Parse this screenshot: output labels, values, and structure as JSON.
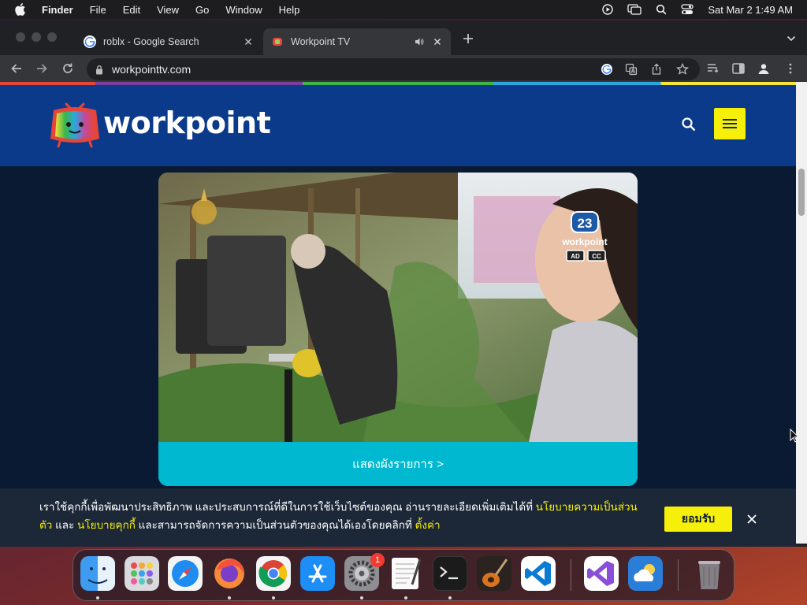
{
  "menubar": {
    "app_name": "Finder",
    "items": [
      "File",
      "Edit",
      "View",
      "Go",
      "Window",
      "Help"
    ],
    "clock": "Sat Mar 2  1:49 AM"
  },
  "tabs": [
    {
      "title": "roblx - Google Search",
      "favicon": "google-icon",
      "active": false
    },
    {
      "title": "Workpoint TV",
      "favicon": "workpoint-favicon",
      "active": true,
      "audio": true
    }
  ],
  "address_bar": {
    "url": "workpointtv.com"
  },
  "site": {
    "logo_text": "workpoint",
    "schedule_link": "แสดงผังรายการ >",
    "video": {
      "channel_number": "23",
      "channel_name": "workpoint",
      "badges": [
        "AD",
        "CC"
      ]
    }
  },
  "cookie": {
    "text_1": "เราใช้คุกกี้เพื่อพัฒนาประสิทธิภาพ และประสบการณ์ที่ดีในการใช้เว็บไซต์ของคุณ อ่านรายละเอียดเพิ่มเติมได้ที่ ",
    "link_privacy": "นโยบายความเป็นส่วนตัว",
    "text_2": " และ ",
    "link_cookie": "นโยบายคุกกี้",
    "text_3": " และสามารถจัดการความเป็นส่วนตัวของคุณได้เองโดยคลิกที่ ",
    "link_settings": "ตั้งค่า",
    "accept_label": "ยอมรับ"
  },
  "dock": {
    "apps": [
      "finder-icon",
      "launchpad-icon",
      "safari-icon",
      "firefox-icon",
      "chrome-icon",
      "app-store-icon",
      "system-settings-icon",
      "textedit-icon",
      "terminal-icon",
      "garageband-icon",
      "vscode-icon",
      "visual-studio-icon",
      "weather-icon",
      "trash-icon"
    ],
    "settings_badge": "1"
  },
  "colors": {
    "accent_yellow": "#f5ef0a",
    "header_blue": "#0b3a8a",
    "page_bg": "#0a1a33",
    "cyan": "#00b9d0"
  }
}
